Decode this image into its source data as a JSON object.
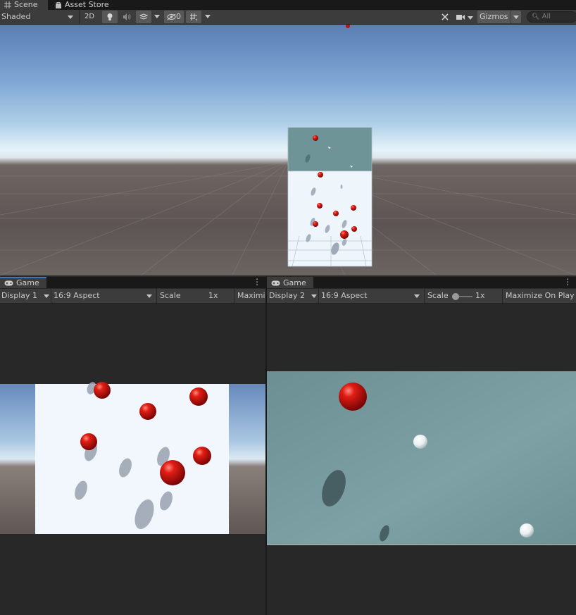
{
  "tabs": {
    "scene": "Scene",
    "asset_store": "Asset Store"
  },
  "scene_toolbar": {
    "draw_mode": "Shaded",
    "toggle_2d": "2D",
    "hidden_count": "0",
    "gizmos": "Gizmos",
    "search_placeholder": "All"
  },
  "game_left": {
    "tab": "Game",
    "display": "Display 1",
    "aspect": "16:9 Aspect",
    "scale_label": "Scale",
    "scale_value": "1x",
    "maximize": "Maximiz"
  },
  "game_right": {
    "tab": "Game",
    "display": "Display 2",
    "aspect": "16:9 Aspect",
    "scale_label": "Scale",
    "scale_value": "1x",
    "maximize": "Maximize On Play"
  },
  "colors": {
    "accent": "#3a79bb",
    "ball_red": "#d41414",
    "panel_bg": "#282828",
    "toolbar_bg": "#3c3c3c"
  },
  "icons": [
    "scene-grid-icon",
    "asset-store-icon",
    "light-icon",
    "audio-icon",
    "effects-icon",
    "visibility-icon",
    "grid-snap-icon",
    "tools-icon",
    "camera-icon",
    "search-icon",
    "gamepad-icon",
    "kebab-menu-icon",
    "chevron-down-icon"
  ]
}
